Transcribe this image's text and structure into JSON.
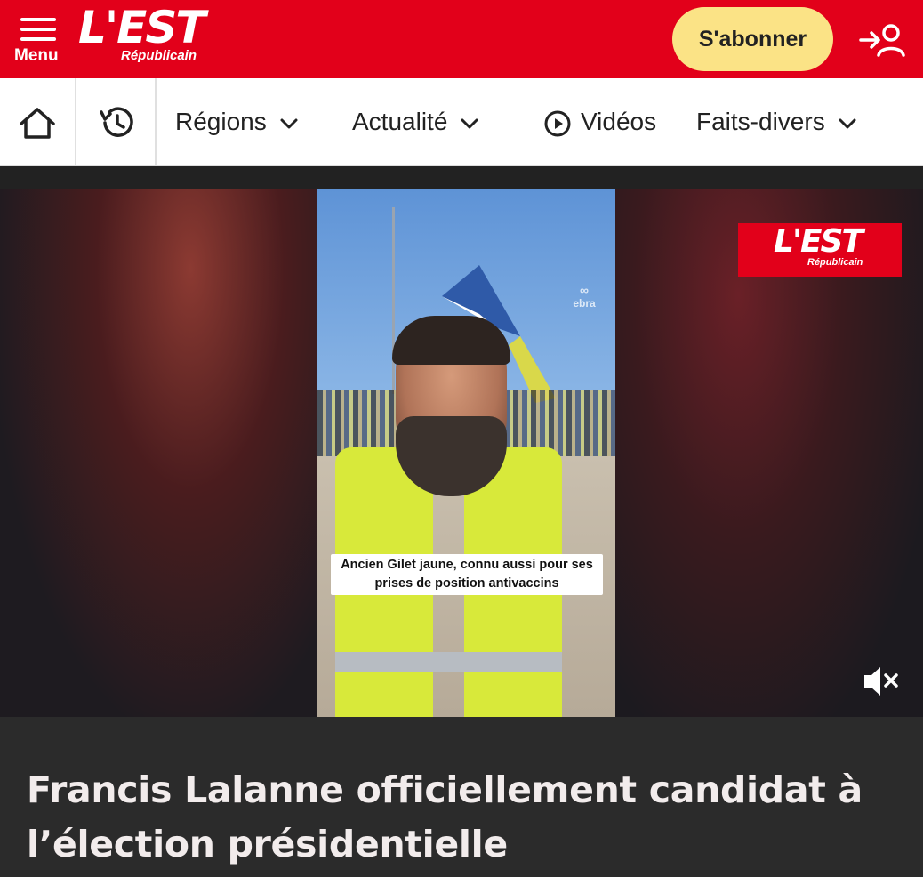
{
  "header": {
    "menu_label": "Menu",
    "logo_main": "L'EST",
    "logo_sub": "Républicain",
    "subscribe_label": "S'abonner",
    "brand_color": "#e2001a",
    "subscribe_color": "#fbe386"
  },
  "nav": {
    "home_icon": "home-icon",
    "history_icon": "history-icon",
    "items": [
      {
        "label": "Régions",
        "icon": "chevron-down-icon"
      },
      {
        "label": "Actualité",
        "icon": "chevron-down-icon"
      },
      {
        "label": "Vidéos",
        "icon": "play-circle-icon"
      },
      {
        "label": "Faits-divers",
        "icon": "chevron-down-icon"
      }
    ]
  },
  "video": {
    "caption": "Ancien Gilet jaune, connu aussi pour ses prises de position antivaccins",
    "watermark": "ebra",
    "overlay_logo_main": "L'EST",
    "overlay_logo_sub": "Républicain",
    "mute_icon": "volume-muted-icon"
  },
  "article": {
    "title": "Francis Lalanne officiellement candidat à l’élection présidentielle"
  }
}
